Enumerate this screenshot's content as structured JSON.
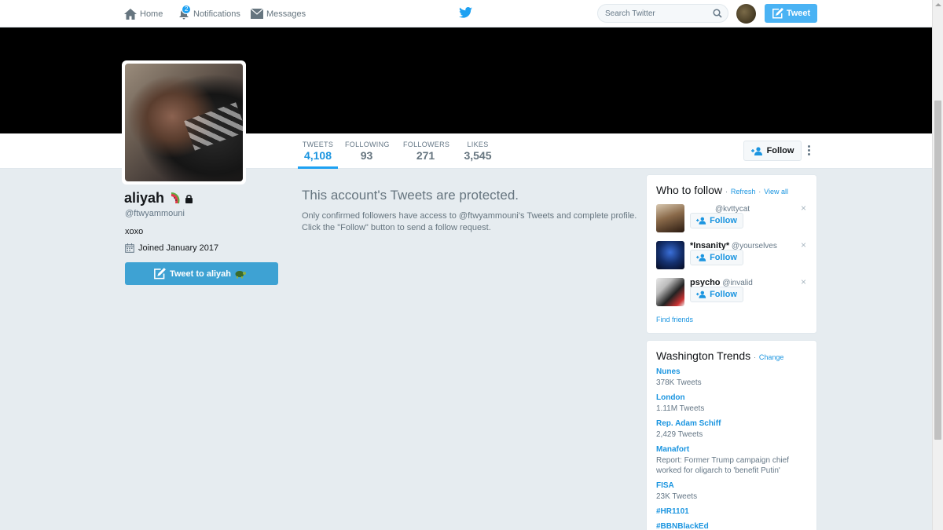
{
  "nav": {
    "home": "Home",
    "notifications": "Notifications",
    "notifications_count": "2",
    "messages": "Messages",
    "search_placeholder": "Search Twitter",
    "tweet_button": "Tweet"
  },
  "profile": {
    "name": "aliyah",
    "handle": "@ftwyammouni",
    "bio": "xoxo",
    "joined": "Joined January 2017",
    "tweet_to": "Tweet to aliyah"
  },
  "stats": [
    {
      "label": "Tweets",
      "value": "4,108"
    },
    {
      "label": "Following",
      "value": "93"
    },
    {
      "label": "Followers",
      "value": "271"
    },
    {
      "label": "Likes",
      "value": "3,545"
    }
  ],
  "follow_button": "Follow",
  "protected": {
    "title": "This account's Tweets are protected.",
    "body_line1": "Only confirmed followers have access to @ftwyammouni's Tweets and complete profile.",
    "body_line2": "Click the \"Follow\" button to send a follow request."
  },
  "who_to_follow": {
    "title": "Who to follow",
    "refresh": "Refresh",
    "view_all": "View all",
    "separator": "·",
    "find_friends": "Find friends",
    "suggestions": [
      {
        "name": "",
        "handle": "@kvttycat",
        "follow": "Follow",
        "dismiss": "×"
      },
      {
        "name": "*Insanity*",
        "handle": "@yourselves",
        "follow": "Follow",
        "dismiss": "×"
      },
      {
        "name": "psycho",
        "handle": "@invalid",
        "follow": "Follow",
        "dismiss": "×"
      }
    ]
  },
  "trends": {
    "title": "Washington Trends",
    "separator": "·",
    "change": "Change",
    "items": [
      {
        "name": "Nunes",
        "context": "378K Tweets"
      },
      {
        "name": "London",
        "context": "1.11M Tweets"
      },
      {
        "name": "Rep. Adam Schiff",
        "context": "2,429 Tweets"
      },
      {
        "name": "Manafort",
        "context": "Report: Former Trump campaign chief worked for oligarch to 'benefit Putin'"
      },
      {
        "name": "FISA",
        "context": "23K Tweets"
      },
      {
        "name": "#HR1101",
        "context": ""
      },
      {
        "name": "#BBNBlackEd",
        "context": ""
      }
    ]
  },
  "colors": {
    "accent": "#1da1f2",
    "link": "#1b95e0",
    "background": "#e6ecf0",
    "tweet_to_button": "#3ea2d3"
  }
}
